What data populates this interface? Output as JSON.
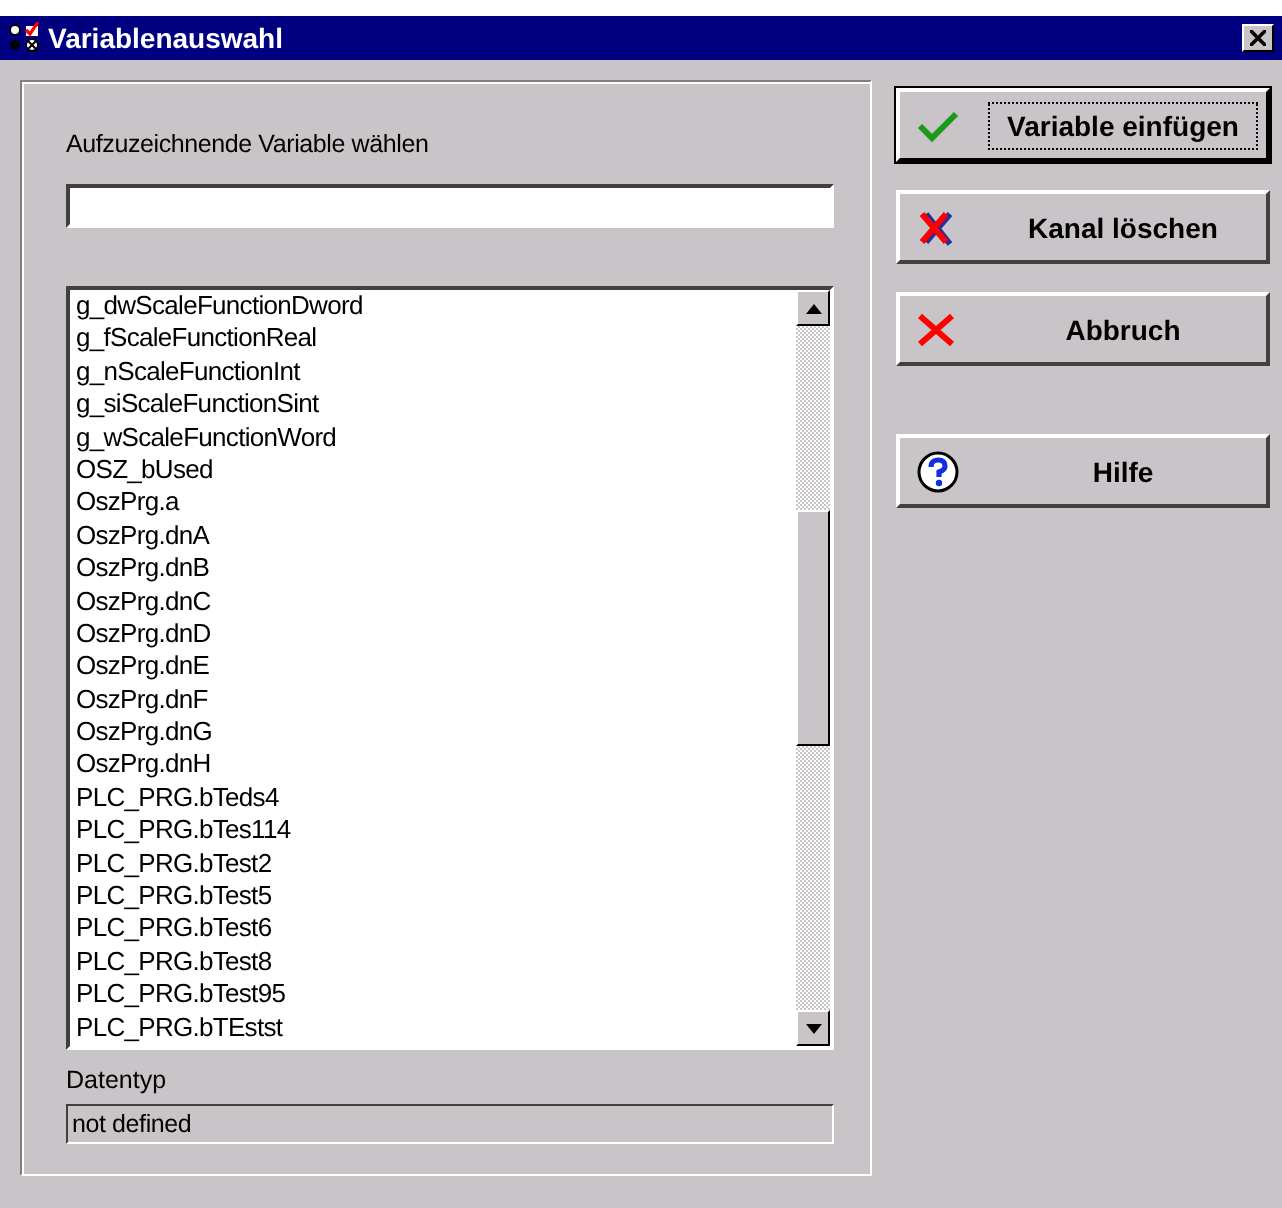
{
  "window": {
    "title": "Variablenauswahl"
  },
  "prompt": "Aufzuzeichnende Variable wählen",
  "variables": [
    {
      "name": "g_dwScaleFunctionDword"
    },
    {
      "name": "g_fScaleFunctionReal"
    },
    {
      "name": "g_nScaleFunctionInt"
    },
    {
      "name": "g_siScaleFunctionSint"
    },
    {
      "name": "g_wScaleFunctionWord"
    },
    {
      "name": "OSZ_bUsed"
    },
    {
      "name": "OszPrg.a"
    },
    {
      "name": "OszPrg.dnA"
    },
    {
      "name": "OszPrg.dnB"
    },
    {
      "name": "OszPrg.dnC"
    },
    {
      "name": "OszPrg.dnD"
    },
    {
      "name": "OszPrg.dnE"
    },
    {
      "name": "OszPrg.dnF"
    },
    {
      "name": "OszPrg.dnG"
    },
    {
      "name": "OszPrg.dnH"
    },
    {
      "name": "PLC_PRG.bTeds4"
    },
    {
      "name": "PLC_PRG.bTes114"
    },
    {
      "name": "PLC_PRG.bTest2"
    },
    {
      "name": "PLC_PRG.bTest5"
    },
    {
      "name": "PLC_PRG.bTest6"
    },
    {
      "name": "PLC_PRG.bTest8"
    },
    {
      "name": "PLC_PRG.bTest95"
    },
    {
      "name": "PLC_PRG.bTEstst"
    }
  ],
  "datatype": {
    "label": "Datentyp",
    "value": "not defined"
  },
  "buttons": [
    {
      "label": "Variable einfügen",
      "kind": "check",
      "default": true
    },
    {
      "label": "Kanal löschen",
      "kind": "delete",
      "default": false
    },
    {
      "label": "Abbruch",
      "kind": "cancel",
      "default": false
    },
    {
      "label": "Hilfe",
      "kind": "help",
      "default": false
    }
  ]
}
